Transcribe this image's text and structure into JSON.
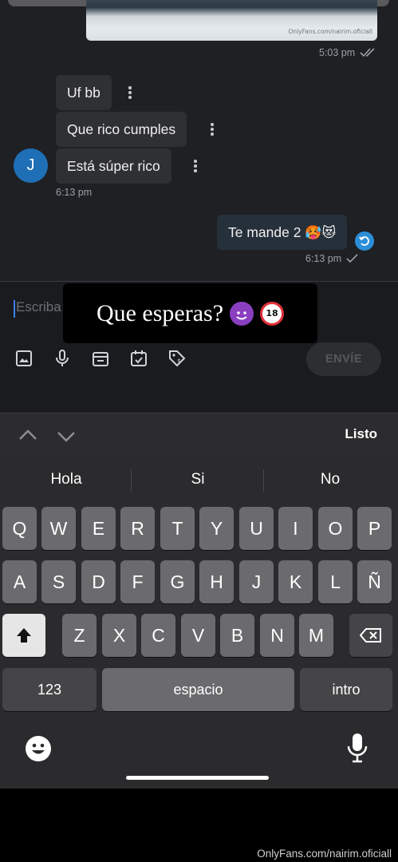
{
  "chat": {
    "prev_time": "5:03 pm",
    "media_watermark": "OnlyFans.com/nairim.oficiall",
    "incoming": {
      "avatar_initial": "J",
      "messages": [
        "Uf bb",
        "Que rico cumples",
        "Está súper rico"
      ],
      "time": "6:13 pm"
    },
    "outgoing": {
      "text": "Te mande 2",
      "emojis": "🥵😻",
      "time": "6:13 pm"
    }
  },
  "composer": {
    "placeholder": "Escriba",
    "send_label": "ENVÍE",
    "tool_icons": [
      "image-icon",
      "microphone-icon",
      "vault-icon",
      "calendar-icon",
      "price-tag-icon"
    ]
  },
  "overlay": {
    "text": "Que esperas?",
    "emoji_18": "18"
  },
  "keyboard": {
    "done_label": "Listo",
    "suggestions": [
      "Hola",
      "Si",
      "No"
    ],
    "row1": [
      "Q",
      "W",
      "E",
      "R",
      "T",
      "Y",
      "U",
      "I",
      "O",
      "P"
    ],
    "row2": [
      "A",
      "S",
      "D",
      "F",
      "G",
      "H",
      "J",
      "K",
      "L",
      "Ñ"
    ],
    "row3": [
      "Z",
      "X",
      "C",
      "V",
      "B",
      "N",
      "M"
    ],
    "numbers_label": "123",
    "space_label": "espacio",
    "return_label": "intro"
  },
  "footer_watermark": "OnlyFans.com/nairim.oficiall",
  "colors": {
    "avatar": "#1e6fb6",
    "cursor": "#3b82f6",
    "reply_badge": "#2b8ed8",
    "chat_bg": "#1f2024",
    "keyboard_bg": "#2b2b2d"
  }
}
